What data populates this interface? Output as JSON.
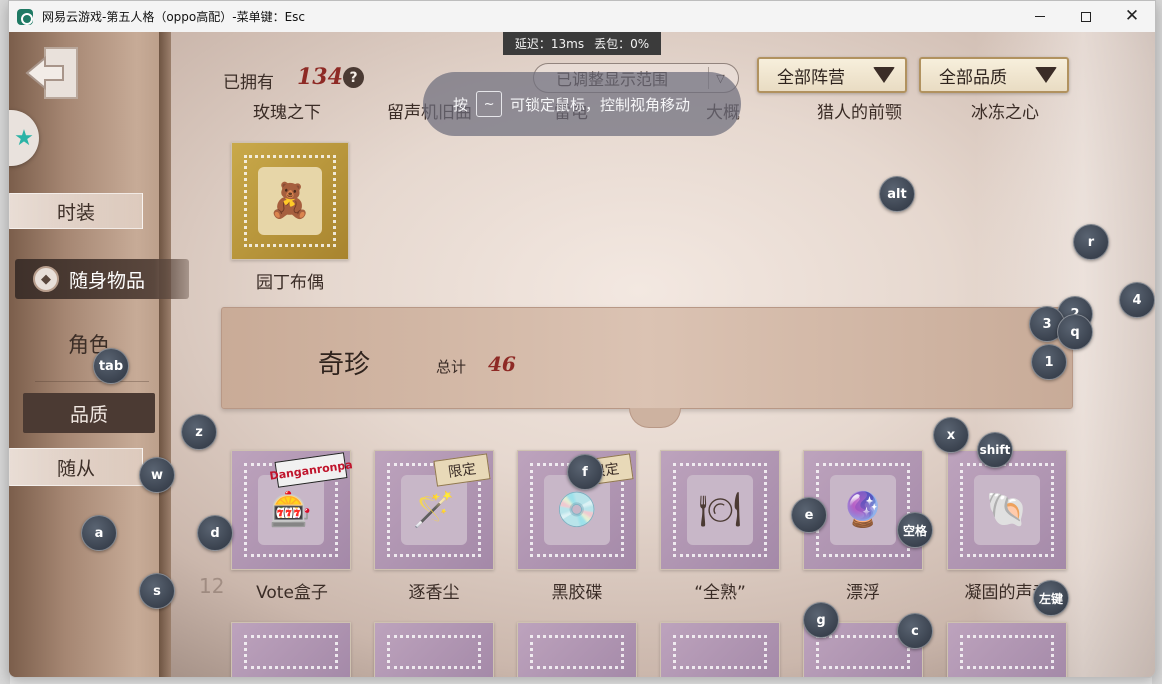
{
  "window": {
    "title": "网易云游戏-第五人格（oppo高配）-菜单键：Esc"
  },
  "stats": {
    "latency": "延迟：13ms",
    "packet_loss": "丢包：0%"
  },
  "lock_tip": {
    "prefix": "按",
    "key": "~",
    "text": "可锁定鼠标，控制视角移动"
  },
  "header": {
    "owned_label": "已拥有",
    "owned_count": "134",
    "help": "?",
    "range_pill": "已调整显示范围",
    "range_toggle": "▽",
    "camp_dropdown": "全部阵营",
    "quality_dropdown": "全部品质"
  },
  "prev_row_names": [
    "玫瑰之下",
    "留声机旧曲",
    "雷电",
    "大概",
    "猎人的前颚",
    "冰冻之心"
  ],
  "nav": {
    "shizhuang": "时装",
    "suishen": "随身物品",
    "juese": "角色",
    "pinzhi": "品质",
    "suicong": "随从"
  },
  "featured_item": {
    "label": "园丁布偶"
  },
  "section": {
    "title": "奇珍",
    "total_label": "总计",
    "total": "46"
  },
  "items": [
    {
      "label": "Vote盒子",
      "badge": "Danganronpa",
      "limited": false
    },
    {
      "label": "逐香尘",
      "limited": true,
      "limited_text": "限定"
    },
    {
      "label": "黑胶碟",
      "limited": true,
      "limited_text": "限定"
    },
    {
      "label": "“全熟”",
      "limited": false
    },
    {
      "label": "漂浮",
      "limited": false
    },
    {
      "label": "凝固的声音",
      "limited": false
    }
  ],
  "faint_number": "12",
  "key_overlays": [
    "alt",
    "r",
    "2",
    "3",
    "q",
    "4",
    "1",
    "tab",
    "z",
    "x",
    "shift",
    "f",
    "w",
    "e",
    "空格",
    "a",
    "d",
    "s",
    "g",
    "c",
    "左键"
  ],
  "colors": {
    "accent_red": "#8e2a25",
    "dark_panel": "#4b3a33",
    "key_bubble": "#3a414d"
  }
}
